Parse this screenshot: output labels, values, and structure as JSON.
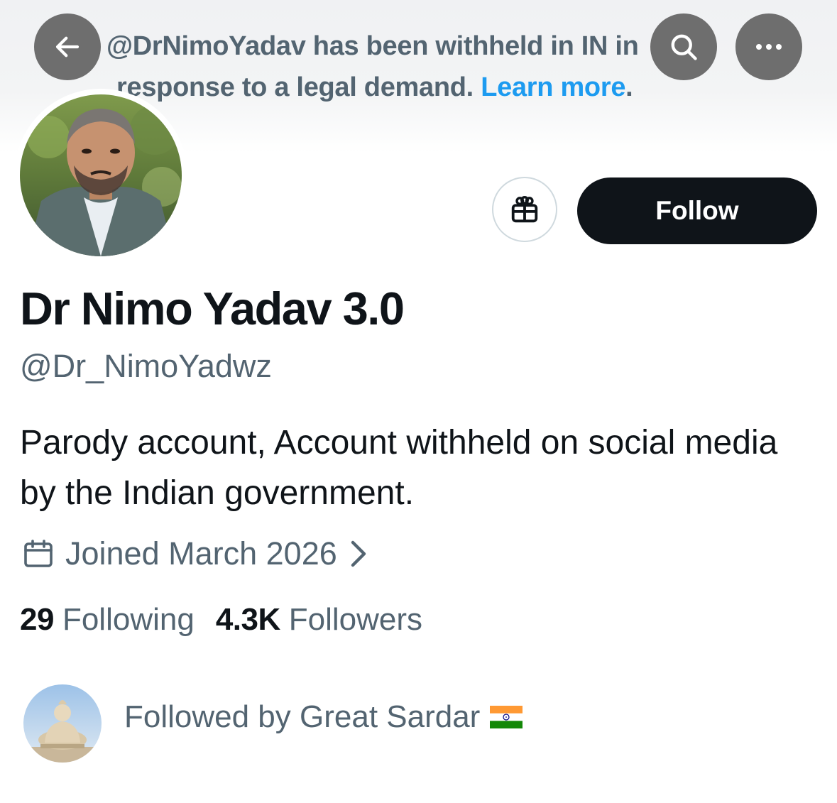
{
  "banner": {
    "notice_line1": "@DrNimoYadav has been withheld in IN in",
    "notice_line2_prefix": "response to a legal demand. ",
    "notice_link": "Learn more",
    "notice_suffix": ".",
    "link_color": "#1d9bf0"
  },
  "nav": {
    "back_icon": "arrow-left-icon",
    "search_icon": "search-icon",
    "more_icon": "more-horizontal-icon"
  },
  "profile": {
    "display_name": "Dr Nimo Yadav 3.0",
    "handle": "@Dr_NimoYadwz",
    "bio": "Parody account, Account withheld on social media by the Indian government.",
    "joined": "Joined March 2026",
    "following_count": "29",
    "following_label": "Following",
    "followers_count": "4.3K",
    "followers_label": "Followers",
    "followed_by": "Followed by Great Sardar",
    "followed_by_flag": "india-flag-icon"
  },
  "actions": {
    "gift_icon": "gift-icon",
    "follow_label": "Follow",
    "follow_bg": "#0f1419"
  }
}
